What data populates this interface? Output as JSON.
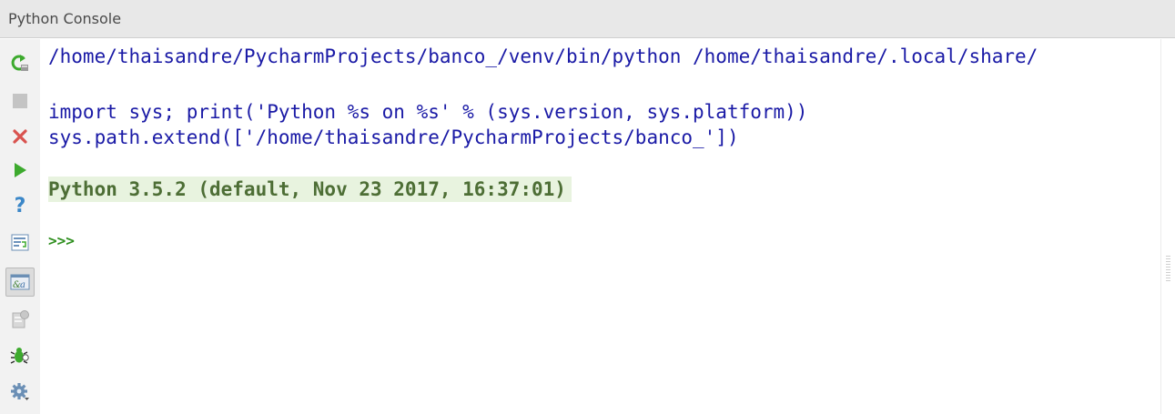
{
  "panel": {
    "title": "Python Console"
  },
  "toolbar": {
    "tools": [
      {
        "name": "rerun-console",
        "icon": "rerun-icon"
      },
      {
        "name": "stop",
        "icon": "stop-icon"
      },
      {
        "name": "close",
        "icon": "close-icon"
      },
      {
        "name": "execute",
        "icon": "play-icon"
      },
      {
        "name": "help",
        "icon": "help-icon"
      },
      {
        "name": "soft-wraps",
        "icon": "soft-wrap-icon"
      },
      {
        "name": "show-variables",
        "icon": "variables-icon",
        "active": true
      },
      {
        "name": "console-history",
        "icon": "history-icon"
      },
      {
        "name": "attach-debugger",
        "icon": "bug-icon"
      },
      {
        "name": "settings",
        "icon": "gear-icon"
      }
    ]
  },
  "console": {
    "command_line": "/home/thaisandre/PycharmProjects/banco_/venv/bin/python /home/thaisandre/.local/share/",
    "import_line": "import sys; print('Python %s on %s' % (sys.version, sys.platform))",
    "path_line": "sys.path.extend(['/home/thaisandre/PycharmProjects/banco_'])",
    "banner": "Python 3.5.2 (default, Nov 23 2017, 16:37:01)",
    "prompt": ">>>"
  },
  "colors": {
    "code_text": "#1a1aa6",
    "banner_text": "#4d6e35",
    "banner_background": "#e8f3df",
    "prompt": "#2f8f1f",
    "stop_icon": "#c4c4c4",
    "close_icon": "#d9534f",
    "play_icon": "#3daa2e",
    "help_icon": "#3b87c8"
  }
}
